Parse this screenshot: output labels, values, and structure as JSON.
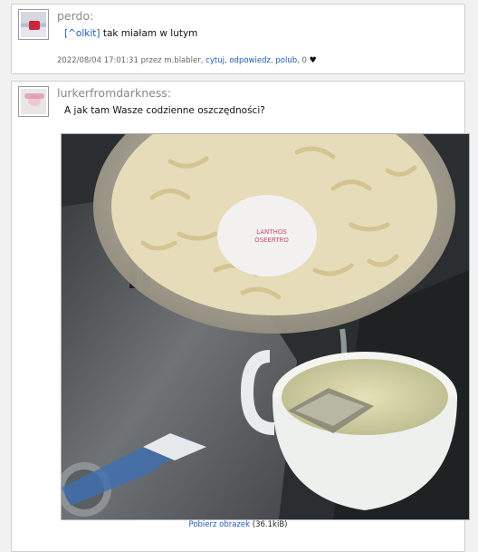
{
  "posts": [
    {
      "username": "perdo:",
      "reply_link": "^olkit",
      "message": " tak miałam w lutym",
      "meta": {
        "datetime": "2022/08/04 17:01:31",
        "by_text": " przez m.blabler, ",
        "action_quote": "cytuj",
        "action_reply": "odpowiedz",
        "action_like": "polub",
        "likes": "0"
      }
    },
    {
      "username": "lurkerfromdarkness:",
      "message": "A jak tam Wasze codzienne oszczędności?",
      "image": {
        "download_label": "Pobierz obrazek",
        "size": "(36.1kiB)",
        "egg_stamp": "LANTHOS OSEERTRO"
      }
    }
  ],
  "colors": {
    "link": "#1b5bb7",
    "username": "#888888"
  },
  "icons": {
    "like": "heart-icon"
  }
}
